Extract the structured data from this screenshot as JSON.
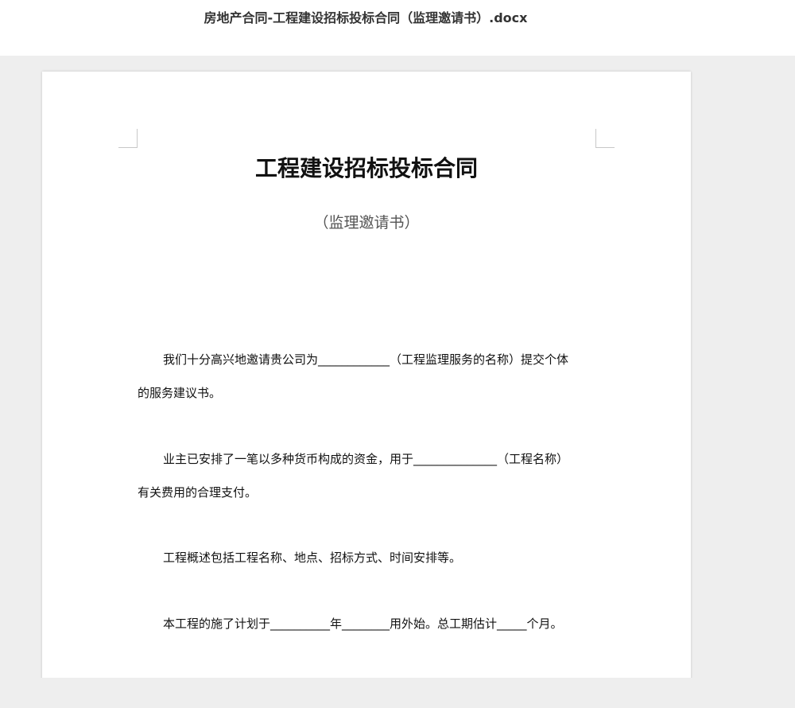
{
  "header": {
    "file_title": "房地产合同-工程建设招标投标合同（监理邀请书）.docx"
  },
  "document": {
    "title": "工程建设招标投标合同",
    "subtitle": "（监理邀请书）",
    "paragraphs": [
      {
        "line1": "我们十分高兴地邀请贵公司为____________（工程监理服务的名称）提交个体",
        "line2": "的服务建议书。"
      },
      {
        "line1": "业主已安排了一笔以多种货币构成的资金，用于______________（工程名称）",
        "line2": "有关费用的合理支付。"
      },
      {
        "line1": "工程概述包括工程名称、地点、招标方式、时间安排等。"
      },
      {
        "line1": "本工程的施了计划于__________年________用外始。总工期估计_____个月。"
      }
    ]
  }
}
